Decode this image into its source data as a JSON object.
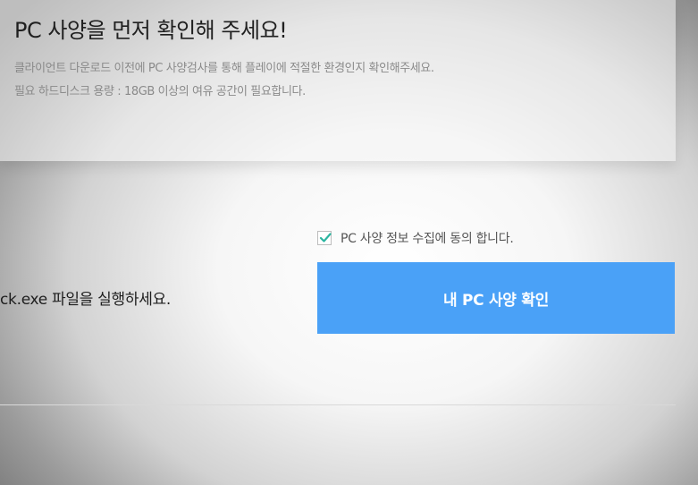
{
  "notice": {
    "title": "PC 사양을 먼저 확인해 주세요!",
    "desc_line1": "클라이언트 다운로드 이전에 PC 사양검사를 통해 플레이에 적절한 환경인지 확인해주세요.",
    "desc_line2": "필요 하드디스크 용량 : 18GB 이상의 여유 공간이 필요합니다."
  },
  "consent": {
    "checked": true,
    "label": "PC 사양 정보 수집에 동의 합니다."
  },
  "instruction": "ck.exe 파일을 실행하세요.",
  "check_button": {
    "label": "내 PC 사양 확인"
  },
  "colors": {
    "accent": "#4aa1f7",
    "check": "#2bb5a0"
  },
  "icons": {
    "checkmark": "checkmark-icon"
  }
}
